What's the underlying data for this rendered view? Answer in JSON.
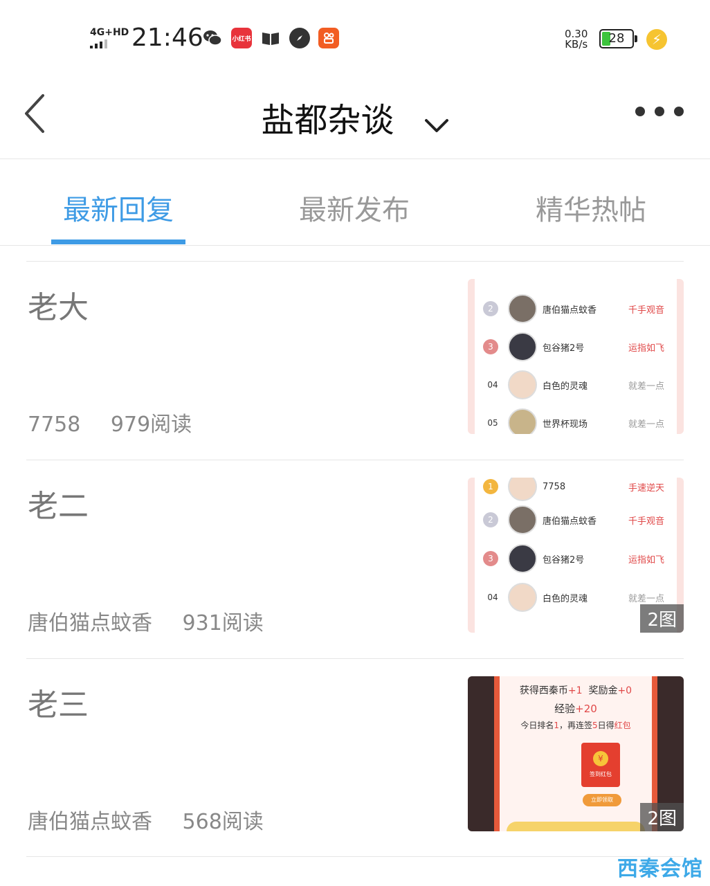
{
  "status_bar": {
    "network": "4G+HD",
    "time": "21:46",
    "speed_value": "0.30",
    "speed_unit": "KB/s",
    "battery": "28",
    "app_icons": [
      "wechat-icon",
      "xiaohongshu-icon",
      "reader-icon",
      "compass-icon",
      "kuaishou-icon"
    ],
    "xiaohongshu_label": "小红书"
  },
  "nav": {
    "title": "盐都杂谈"
  },
  "tabs": [
    {
      "label": "最新回复",
      "active": true
    },
    {
      "label": "最新发布",
      "active": false
    },
    {
      "label": "精华热帖",
      "active": false
    }
  ],
  "posts": [
    {
      "title": "老大",
      "author": "7758",
      "reads": "979阅读",
      "thumb": {
        "type": "ranking",
        "rows": [
          {
            "rank": "2",
            "name": "唐伯猫点蚊香",
            "tag": "千手观音"
          },
          {
            "rank": "3",
            "name": "包谷猪2号",
            "tag": "运指如飞"
          },
          {
            "rank": "04",
            "name": "白色的灵魂",
            "tag": "就差一点"
          },
          {
            "rank": "05",
            "name": "世界杯现场",
            "tag": "就差一点"
          }
        ]
      }
    },
    {
      "title": "老二",
      "author": "唐伯猫点蚊香",
      "reads": "931阅读",
      "badge": "2图",
      "thumb": {
        "type": "ranking",
        "rows": [
          {
            "rank": "1",
            "name": "7758",
            "tag": "手速逆天"
          },
          {
            "rank": "2",
            "name": "唐伯猫点蚊香",
            "tag": "千手观音"
          },
          {
            "rank": "3",
            "name": "包谷猪2号",
            "tag": "运指如飞"
          },
          {
            "rank": "04",
            "name": "白色的灵魂",
            "tag": "就差一点"
          }
        ]
      }
    },
    {
      "title": "老三",
      "author": "唐伯猫点蚊香",
      "reads": "568阅读",
      "badge": "2图",
      "thumb": {
        "type": "signin",
        "line1_a": "获得西秦币",
        "line1_b": "+1",
        "line1_c": "奖励金",
        "line1_d": "+0",
        "line2_a": "经验",
        "line2_b": "+20",
        "line3_a": "今日排名",
        "line3_b": "1",
        "line3_c": "，再连签",
        "line3_d": "5",
        "line3_e": "日得",
        "line3_f": "红包",
        "envelope_label": "签到红包",
        "coin_symbol": "¥",
        "claim_label": "立即领取"
      }
    }
  ],
  "watermark": "西秦会馆",
  "colors": {
    "accent": "#3e9be5",
    "red_tag": "#e04848",
    "muted_text": "#888888"
  }
}
